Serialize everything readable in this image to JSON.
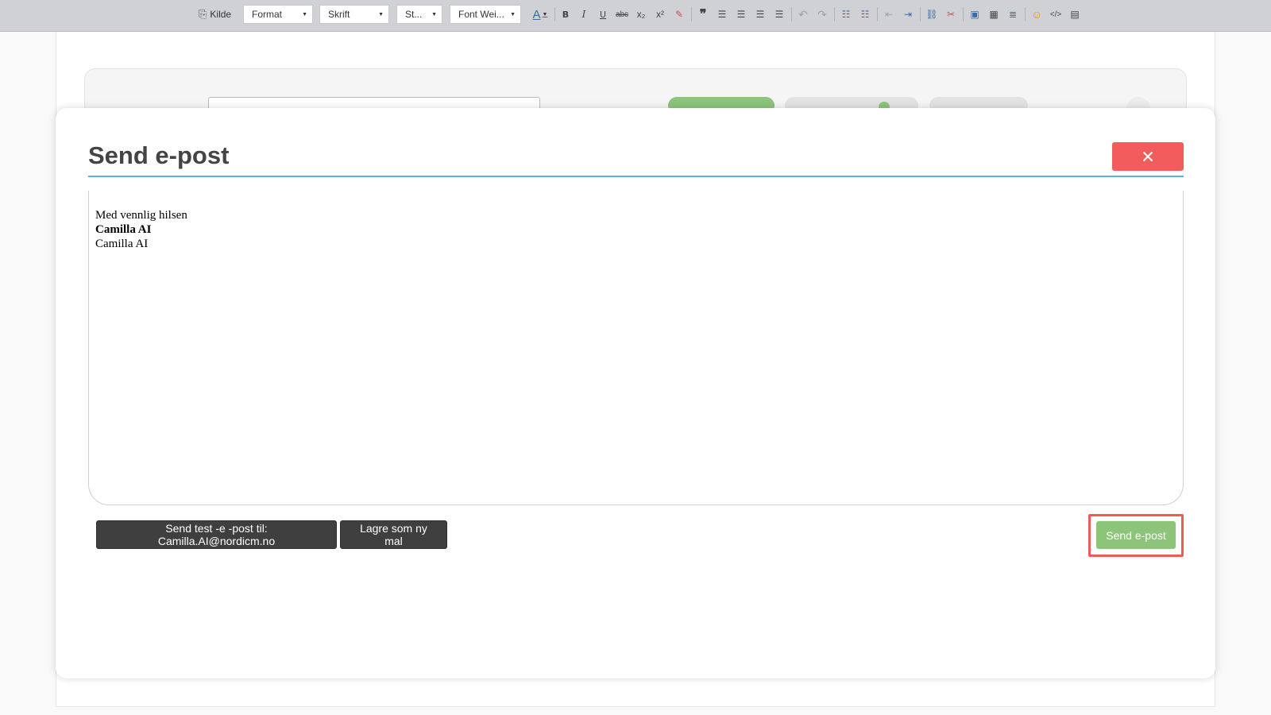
{
  "toolbar": {
    "source_label": "Kilde",
    "format_label": "Format",
    "font_label": "Skrift",
    "size_label": "St...",
    "weight_label": "Font Wei...",
    "text_color_glyph": "A",
    "bold_glyph": "B",
    "italic_glyph": "I",
    "underline_glyph": "U",
    "strike_glyph": "abc",
    "subscript_glyph": "x₂",
    "superscript_glyph": "x²",
    "icons": [
      "source-icon",
      "text-color-icon",
      "bold-icon",
      "italic-icon",
      "underline-icon",
      "strikethrough-icon",
      "subscript-icon",
      "superscript-icon",
      "remove-format-icon",
      "blockquote-icon",
      "align-left-icon",
      "align-center-icon",
      "align-right-icon",
      "justify-icon",
      "undo-icon",
      "redo-icon",
      "numbered-list-icon",
      "bullet-list-icon",
      "outdent-icon",
      "indent-icon",
      "link-icon",
      "unlink-icon",
      "image-icon",
      "table-icon",
      "horizontal-rule-icon",
      "emoji-icon",
      "code-icon",
      "special-char-icon"
    ]
  },
  "modal": {
    "title": "Send e-post",
    "close_glyph": "×"
  },
  "editor": {
    "line1": "Med vennlig hilsen",
    "line2": "Camilla AI",
    "line3": "Camilla AI"
  },
  "actions": {
    "test_label": "Send test -e -post til: Camilla.AI@nordicm.no",
    "save_template_label": "Lagre som ny mal",
    "send_label": "Send e-post"
  },
  "colors": {
    "accent_rule": "#5bb3d6",
    "close": "#f25c5c",
    "send": "#8cc47a",
    "highlight": "#ef5b5b",
    "dark_button": "#3f3f3f"
  }
}
